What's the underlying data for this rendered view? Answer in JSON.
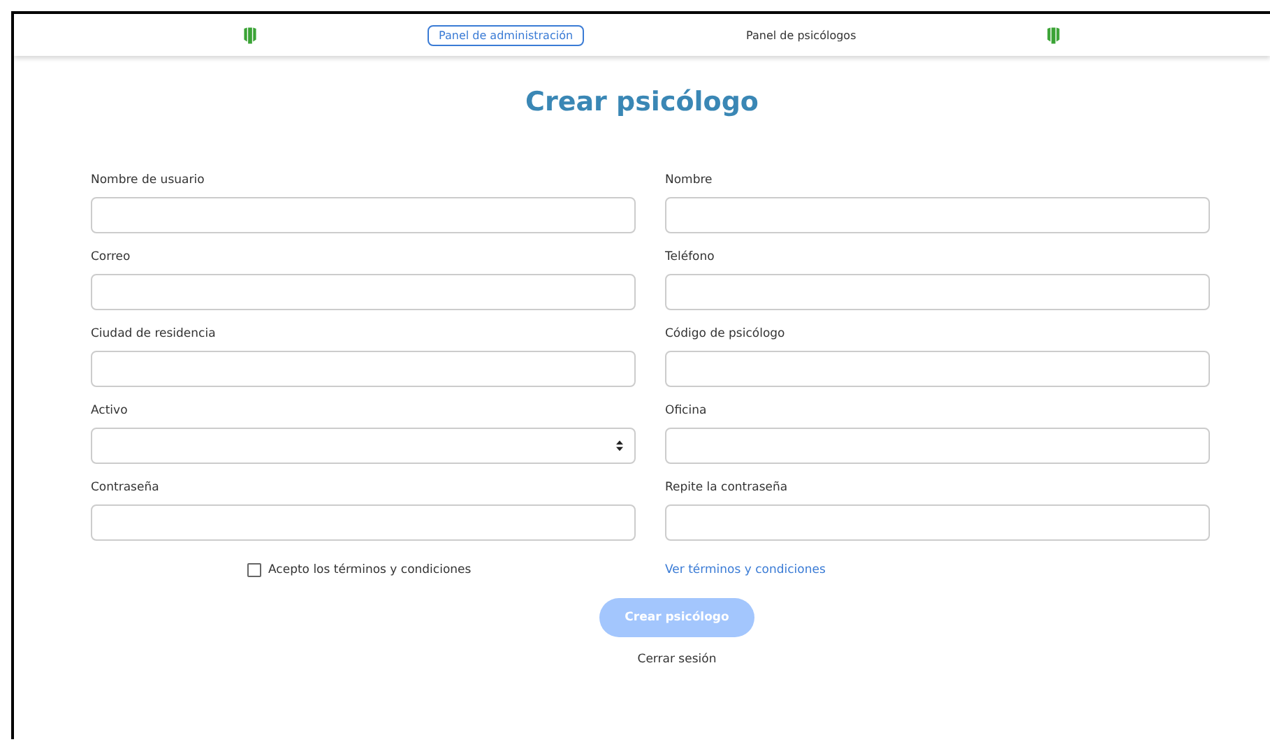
{
  "nav": {
    "items": [
      {
        "label": "Panel de administración",
        "selected": true
      },
      {
        "label": "Panel de psicólogos",
        "selected": false
      }
    ]
  },
  "title": "Crear psicólogo",
  "fields": [
    {
      "label": "Nombre de usuario",
      "kind": "text"
    },
    {
      "label": "Nombre",
      "kind": "text"
    },
    {
      "label": "Correo",
      "kind": "text"
    },
    {
      "label": "Teléfono",
      "kind": "text"
    },
    {
      "label": "Ciudad de residencia",
      "kind": "text"
    },
    {
      "label": "Código de psicólogo",
      "kind": "text"
    },
    {
      "label": "Activo",
      "kind": "select"
    },
    {
      "label": "Oficina",
      "kind": "text"
    },
    {
      "label": "Contraseña",
      "kind": "password"
    },
    {
      "label": "Repite la contraseña",
      "kind": "password"
    }
  ],
  "terms": {
    "label": "Acepto los términos y condiciones",
    "checked": false,
    "link": "Ver términos y condiciones"
  },
  "submit": {
    "label": "Crear psicólogo",
    "disabled": true
  },
  "logout": "Cerrar sesión"
}
